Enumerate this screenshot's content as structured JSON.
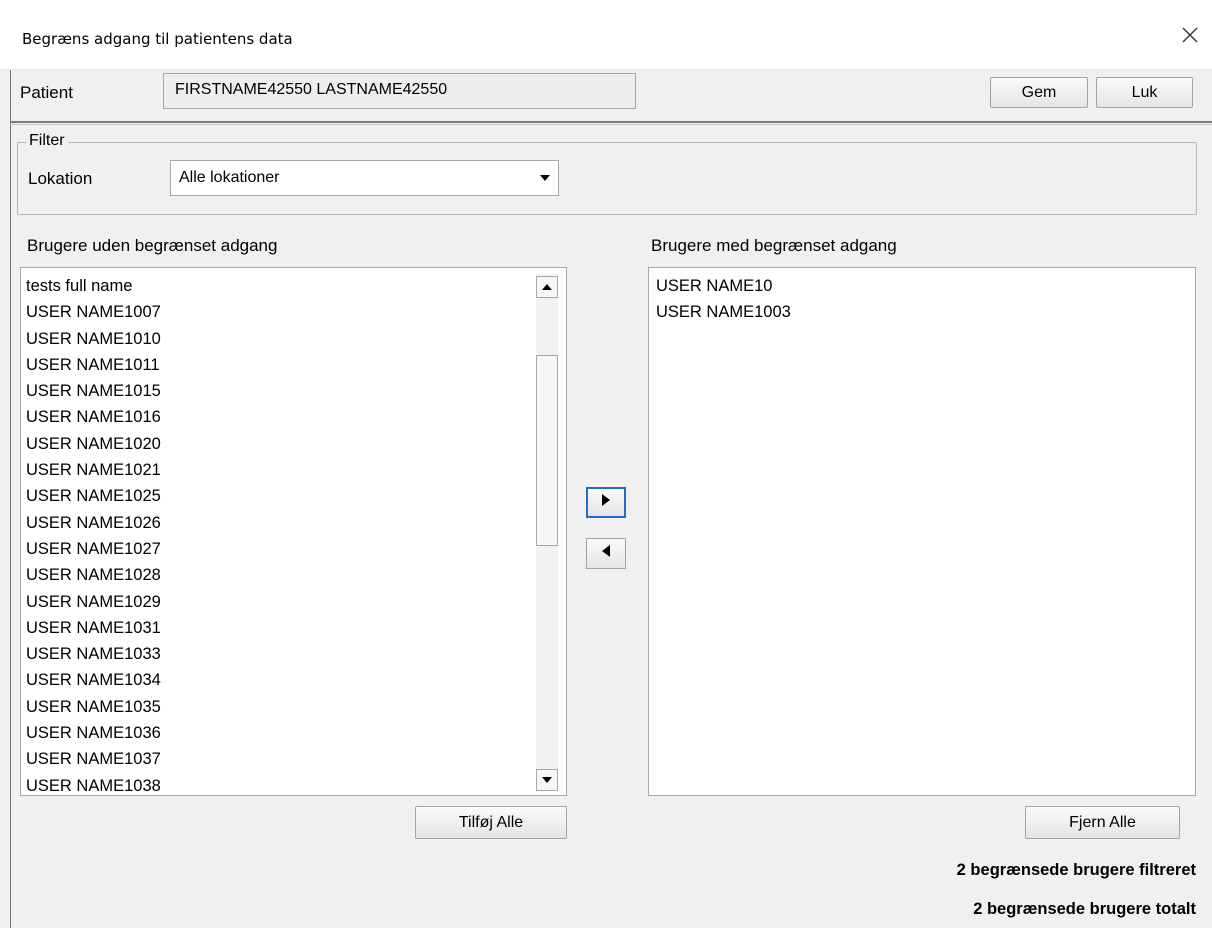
{
  "window": {
    "title": "Begræns adgang til patientens data",
    "close_icon": "close-icon"
  },
  "patient": {
    "label": "Patient",
    "value": "FIRSTNAME42550 LASTNAME42550"
  },
  "actions": {
    "save_label": "Gem",
    "close_label": "Luk"
  },
  "filter": {
    "legend": "Filter",
    "location_label": "Lokation",
    "location_value": "Alle lokationer",
    "dropdown_icon": "chevron-down-icon"
  },
  "unrestricted": {
    "heading": "Brugere uden begrænset adgang",
    "items": [
      "tests full name",
      "USER NAME1007",
      "USER NAME1010",
      "USER NAME1011",
      "USER NAME1015",
      "USER NAME1016",
      "USER NAME1020",
      "USER NAME1021",
      "USER NAME1025",
      "USER NAME1026",
      "USER NAME1027",
      "USER NAME1028",
      "USER NAME1029",
      "USER NAME1031",
      "USER NAME1033",
      "USER NAME1034",
      "USER NAME1035",
      "USER NAME1036",
      "USER NAME1037",
      "USER NAME1038"
    ],
    "add_all_label": "Tilføj Alle"
  },
  "restricted": {
    "heading": "Brugere med begrænset adgang",
    "items": [
      "USER NAME10",
      "USER NAME1003"
    ],
    "remove_all_label": "Fjern Alle"
  },
  "transfer": {
    "add_icon": "arrow-right-icon",
    "remove_icon": "arrow-left-icon"
  },
  "status": {
    "filtered": "2 begrænsede brugere filtreret",
    "total": "2 begrænsede brugere totalt"
  },
  "colors": {
    "background": "#f0f0f0",
    "focus_border": "#1c6fc8"
  }
}
